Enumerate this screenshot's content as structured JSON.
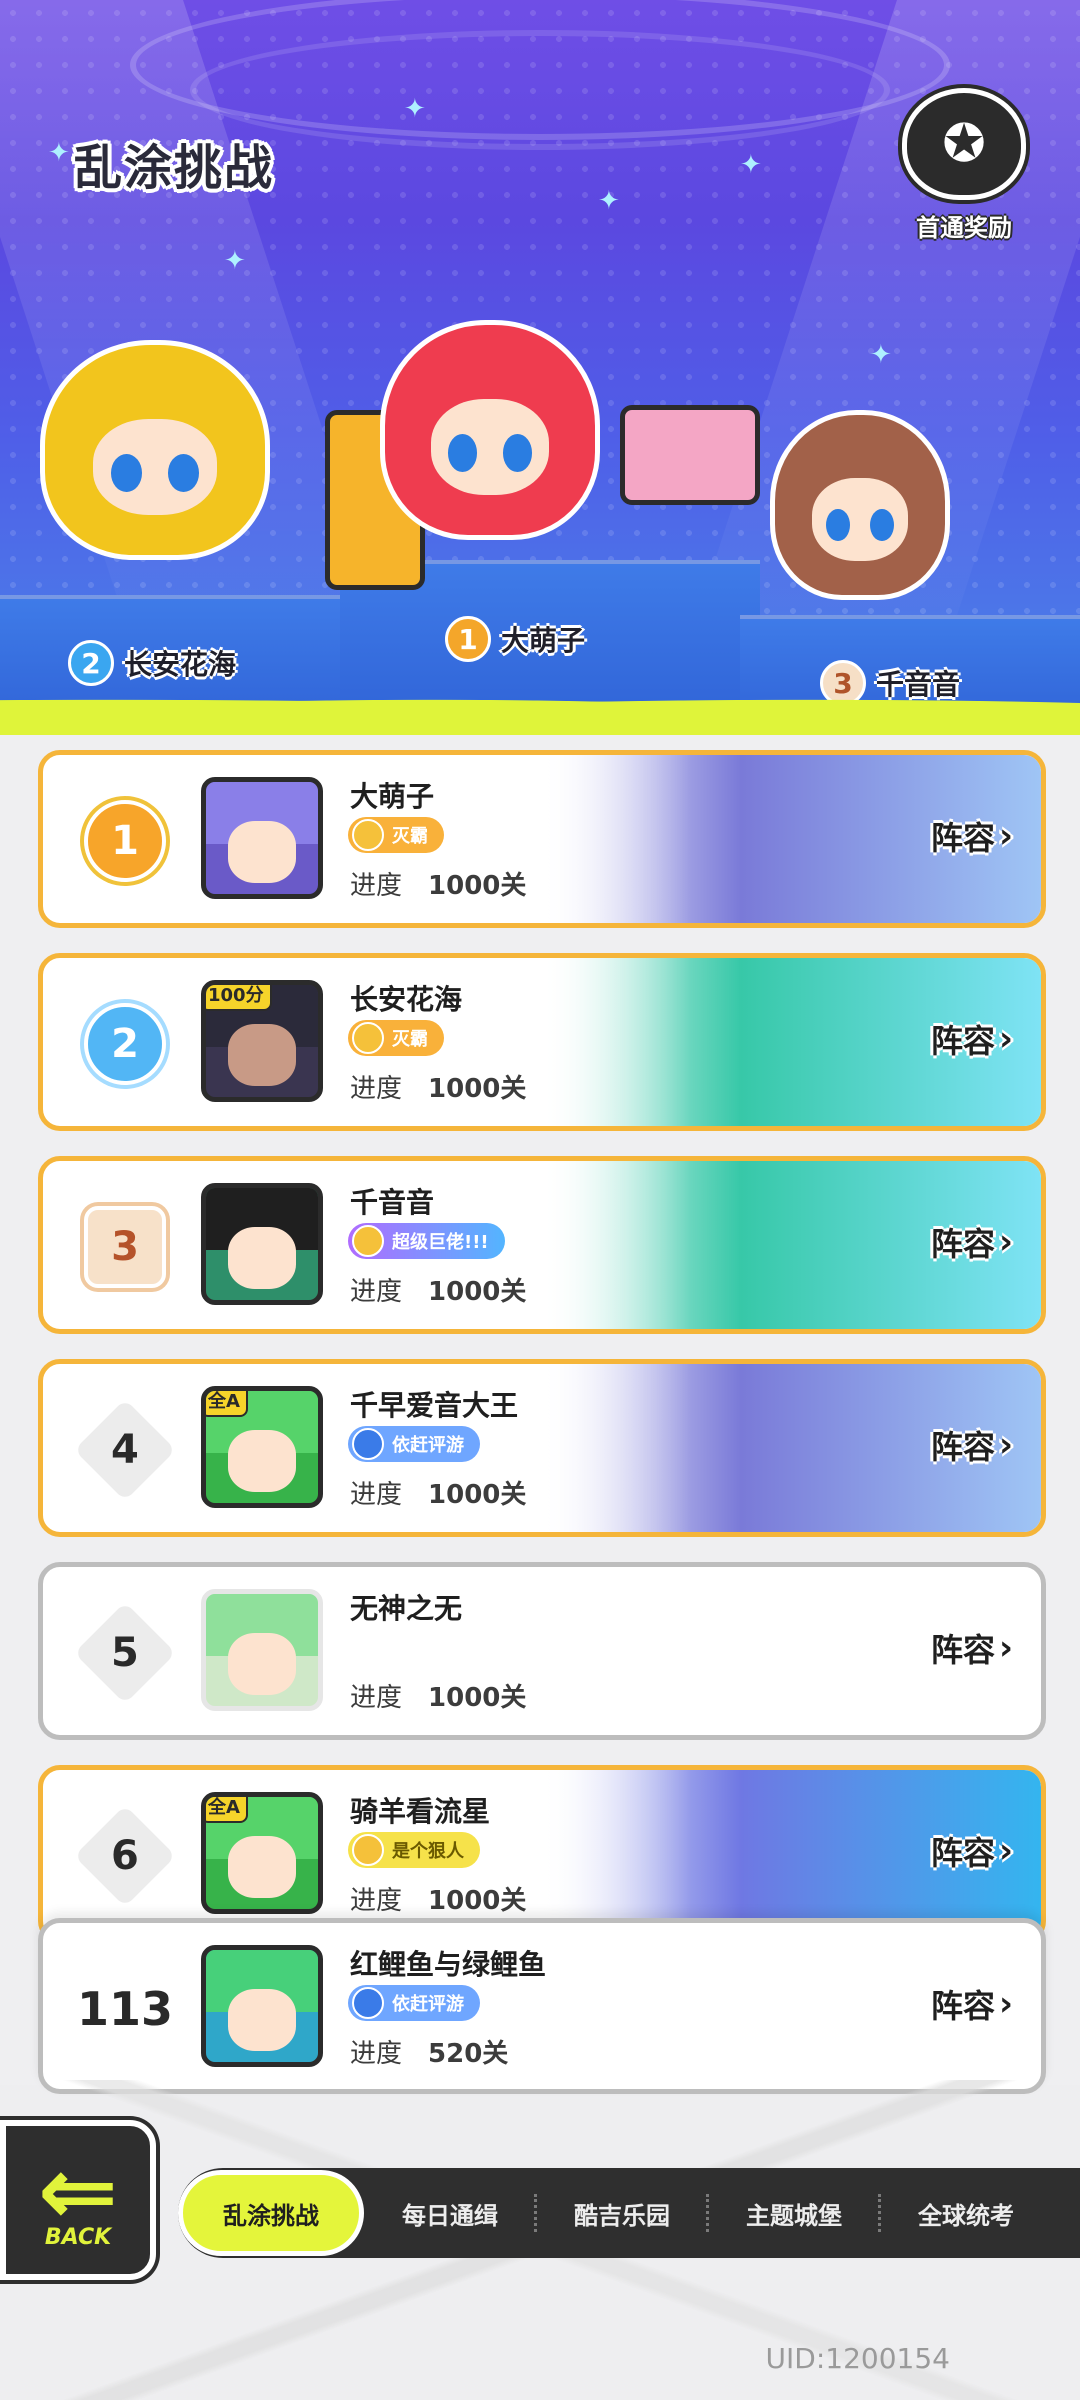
{
  "header": {
    "title": "乱涂挑战",
    "reward_button_label": "首通奖励",
    "podium": [
      {
        "rank": "2",
        "name": "长安花海"
      },
      {
        "rank": "1",
        "name": "大萌子"
      },
      {
        "rank": "3",
        "name": "千音音"
      }
    ]
  },
  "board": {
    "progress_label": "进度",
    "lineup_label": "阵容",
    "rows": [
      {
        "rank": "1",
        "name": "大萌子",
        "badge": "灭霸",
        "progress": "1000关"
      },
      {
        "rank": "2",
        "name": "长安花海",
        "badge": "灭霸",
        "progress": "1000关",
        "avatar_tag": "100分"
      },
      {
        "rank": "3",
        "name": "千音音",
        "badge": "超级巨佬!!!",
        "progress": "1000关"
      },
      {
        "rank": "4",
        "name": "千早爱音大王",
        "badge": "依赶评游",
        "progress": "1000关",
        "avatar_tag": "全A"
      },
      {
        "rank": "5",
        "name": "无神之无",
        "badge": "",
        "progress": "1000关"
      },
      {
        "rank": "6",
        "name": "骑羊看流星",
        "badge": "是个狠人",
        "progress": "1000关",
        "avatar_tag": "全A"
      }
    ],
    "self_row": {
      "rank": "113",
      "name": "红鲤鱼与绿鲤鱼",
      "badge": "依赶评游",
      "progress": "520关"
    }
  },
  "bottom": {
    "back_label": "BACK",
    "tabs": [
      {
        "label": "乱涂挑战",
        "active": true
      },
      {
        "label": "每日通缉",
        "active": false
      },
      {
        "label": "酷吉乐园",
        "active": false
      },
      {
        "label": "主题城堡",
        "active": false
      },
      {
        "label": "全球统考",
        "active": false
      }
    ],
    "uid": "UID:1200154"
  },
  "colors": {
    "accent_lime": "#e4f53b",
    "gold_border": "#f5b53a",
    "stage_purple": "#5b48e0"
  }
}
